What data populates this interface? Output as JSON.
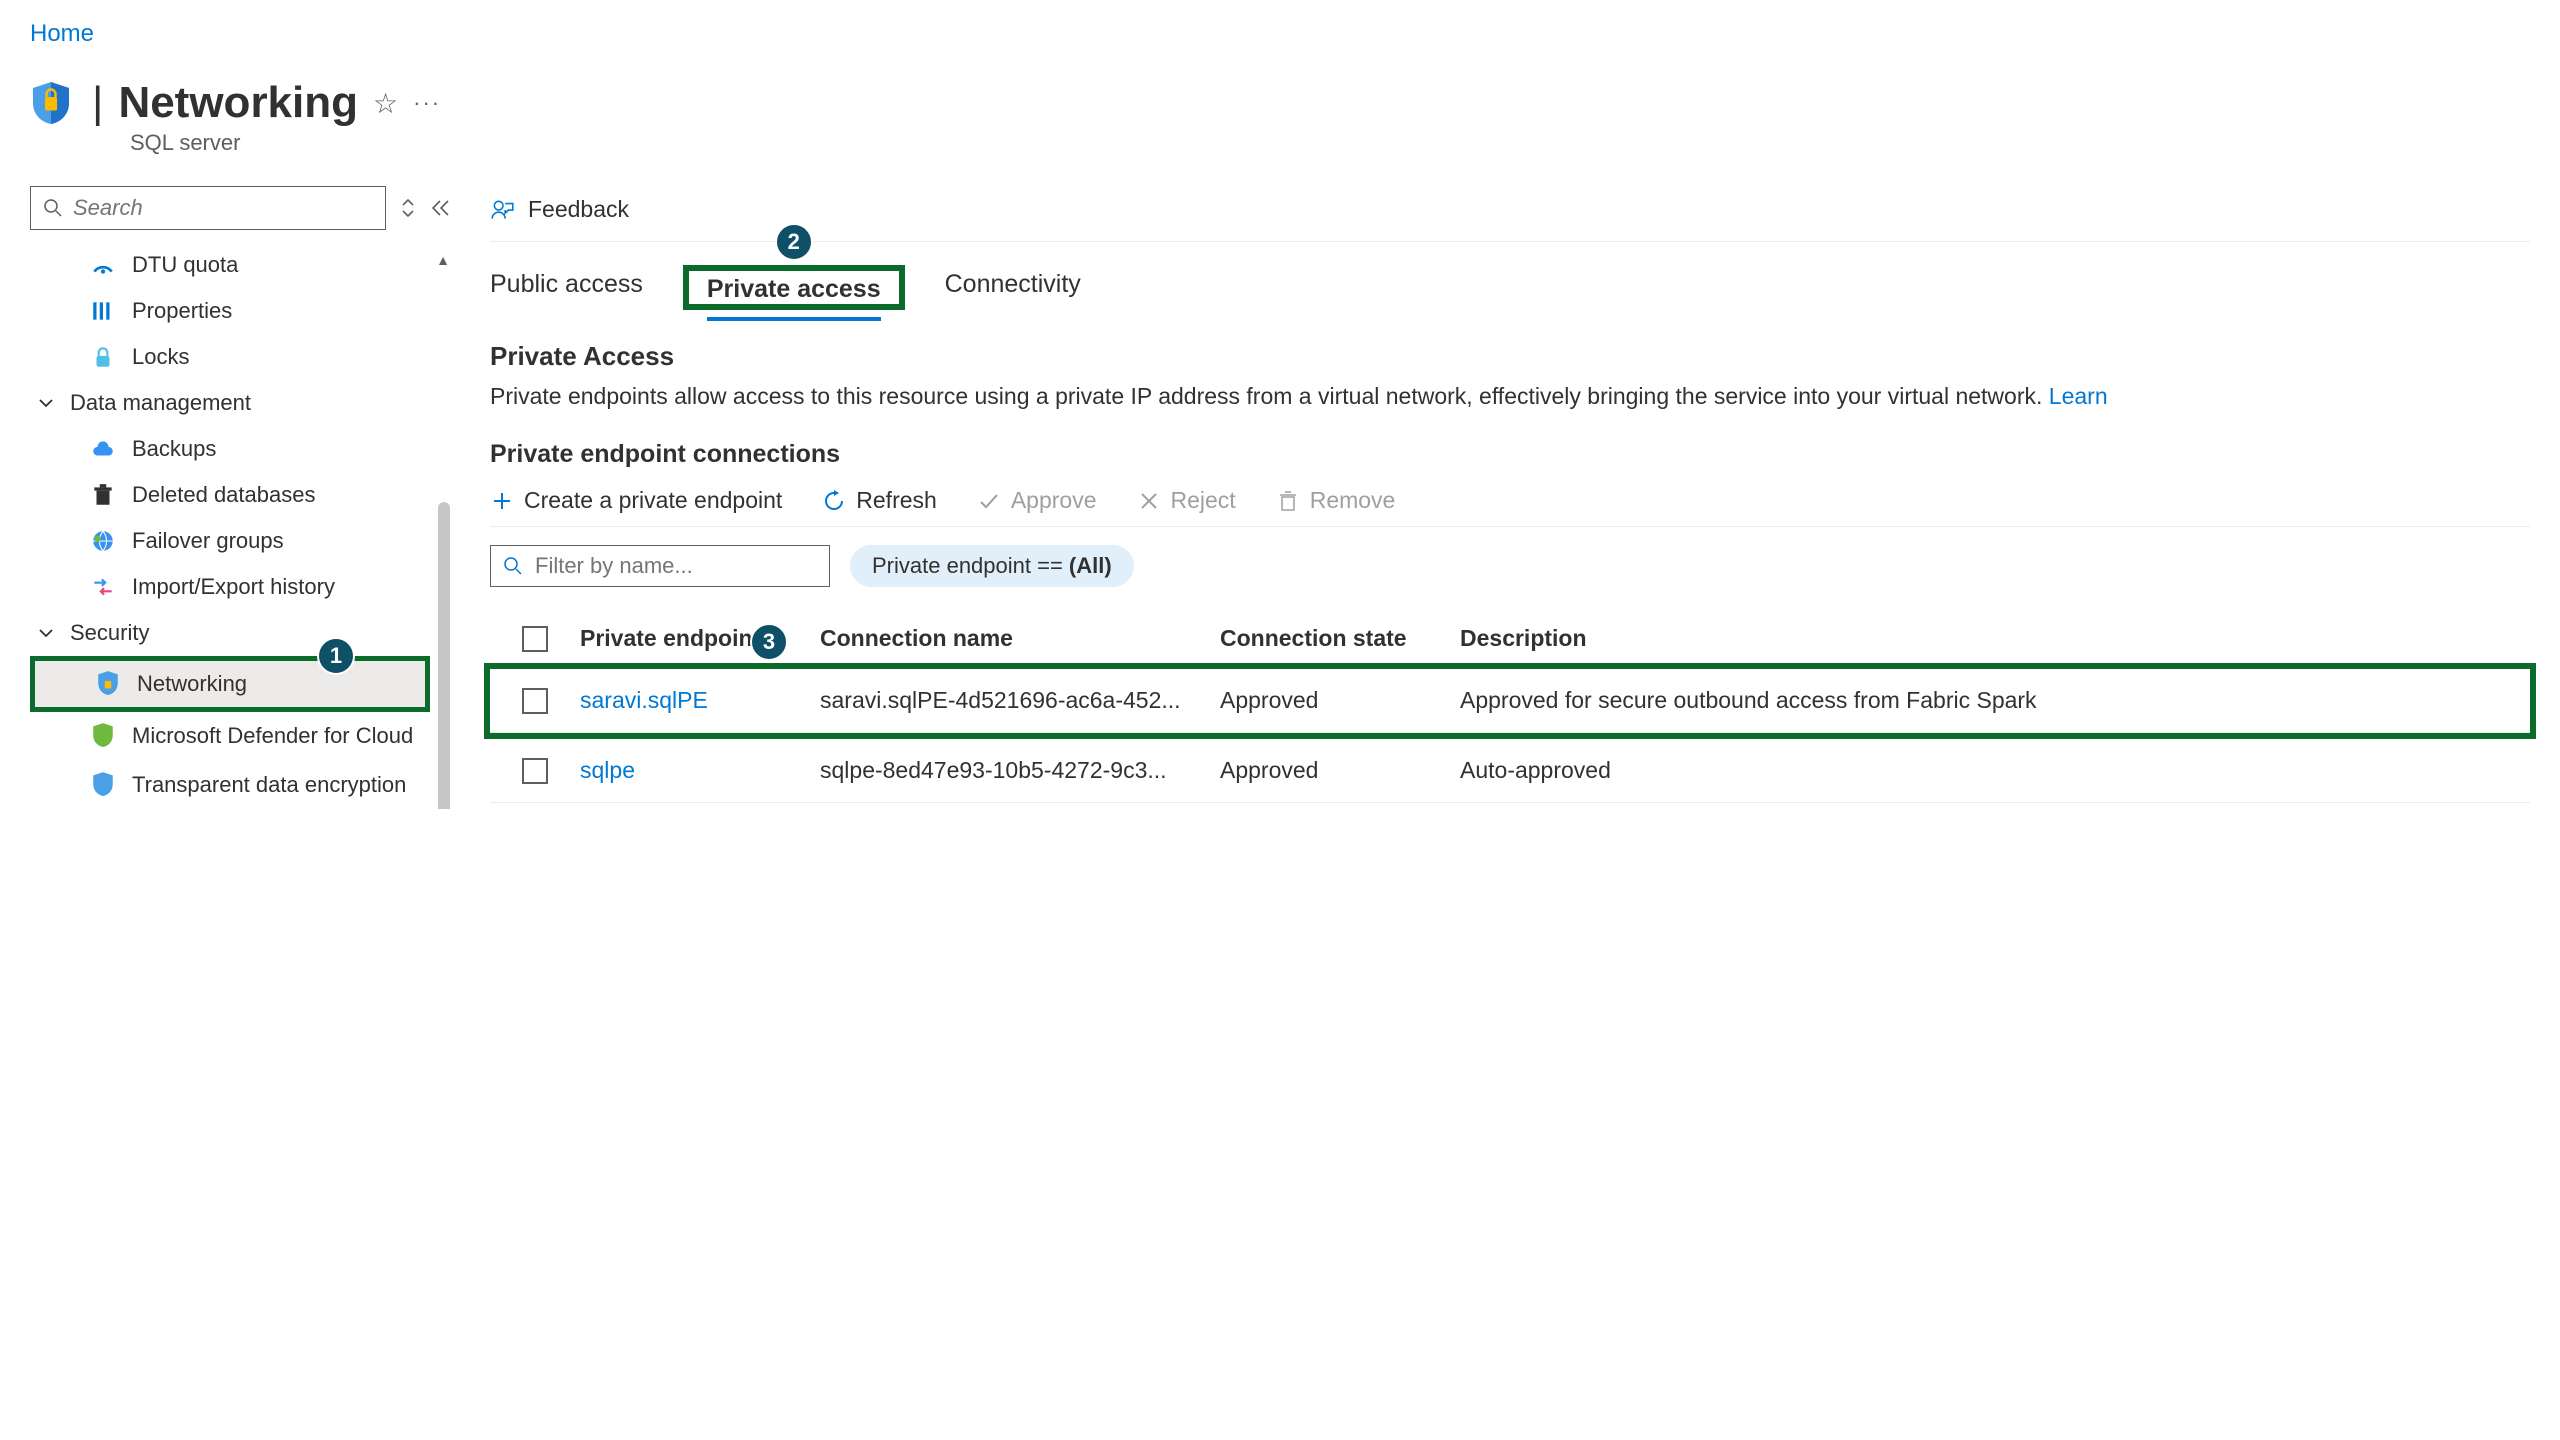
{
  "breadcrumb": {
    "home": "Home"
  },
  "header": {
    "title": "Networking",
    "subtitle": "SQL server"
  },
  "sidebar": {
    "search_placeholder": "Search",
    "items": {
      "dtu": "DTU quota",
      "properties": "Properties",
      "locks": "Locks",
      "data_mgmt": "Data management",
      "backups": "Backups",
      "deleted_db": "Deleted databases",
      "failover": "Failover groups",
      "import_export": "Import/Export history",
      "security": "Security",
      "networking": "Networking",
      "defender": "Microsoft Defender for Cloud",
      "tde": "Transparent data encryption"
    }
  },
  "main": {
    "feedback": "Feedback",
    "tabs": {
      "public": "Public access",
      "private": "Private access",
      "connectivity": "Connectivity"
    },
    "private_access": {
      "title": "Private Access",
      "desc": "Private endpoints allow access to this resource using a private IP address from a virtual network, effectively bringing the service into your virtual network. ",
      "learn": "Learn",
      "connections_title": "Private endpoint connections"
    },
    "toolbar": {
      "create": "Create a private endpoint",
      "refresh": "Refresh",
      "approve": "Approve",
      "reject": "Reject",
      "remove": "Remove"
    },
    "filter": {
      "placeholder": "Filter by name...",
      "pill_prefix": "Private endpoint == ",
      "pill_value": "(All)"
    },
    "table": {
      "headers": {
        "pe": "Private endpoint",
        "conn": "Connection name",
        "state": "Connection state",
        "desc": "Description"
      },
      "rows": [
        {
          "pe": "saravi.sqlPE",
          "conn": "saravi.sqlPE-4d521696-ac6a-452...",
          "state": "Approved",
          "desc": "Approved for secure outbound access from Fabric Spark"
        },
        {
          "pe": "sqlpe",
          "conn": "sqlpe-8ed47e93-10b5-4272-9c3...",
          "state": "Approved",
          "desc": "Auto-approved"
        }
      ]
    }
  },
  "callouts": {
    "c1": "1",
    "c2": "2",
    "c3": "3"
  }
}
